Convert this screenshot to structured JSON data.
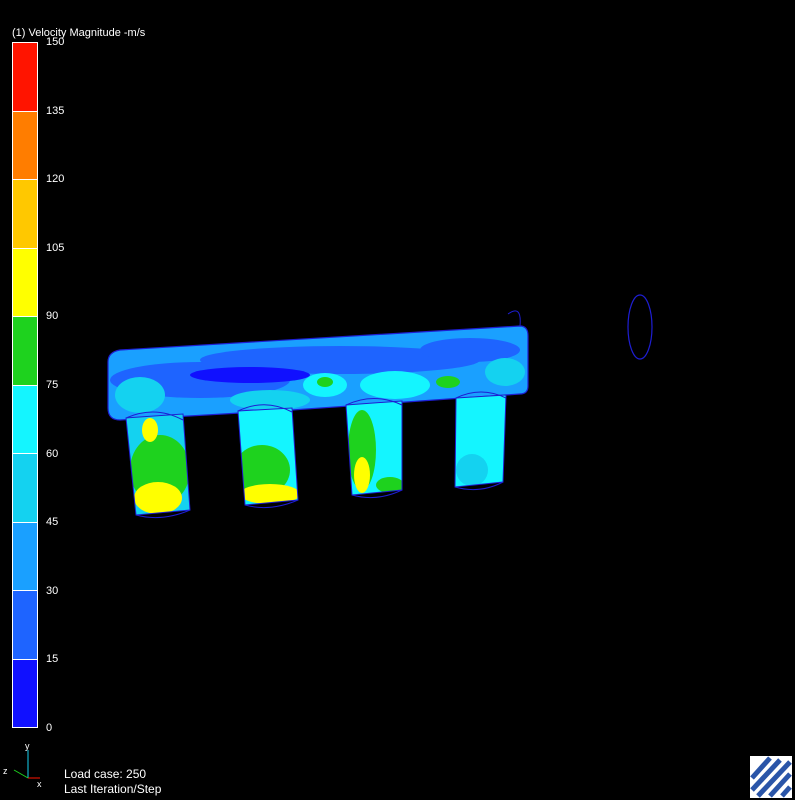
{
  "legend": {
    "title": "(1) Velocity Magnitude -m/s",
    "ticks": [
      "150",
      "135",
      "120",
      "105",
      "90",
      "75",
      "60",
      "45",
      "30",
      "15",
      "0"
    ],
    "band_colors": [
      "#1010ff",
      "#1e64ff",
      "#1aa0ff",
      "#14d2f0",
      "#14f5ff",
      "#1ed21e",
      "#ffff00",
      "#ffc800",
      "#ff7d00",
      "#ff1400"
    ]
  },
  "status": {
    "load_case": "Load case: 250",
    "step": "Last Iteration/Step"
  },
  "triad": {
    "y_label": "y",
    "z_label": "z",
    "x_label": "x"
  },
  "colors": {
    "background": "#000000",
    "outline": "#1e1ed2",
    "low": "#1e64ff",
    "mid": "#14f5ff",
    "high": "#1ed21e",
    "peak": "#ffff00"
  }
}
